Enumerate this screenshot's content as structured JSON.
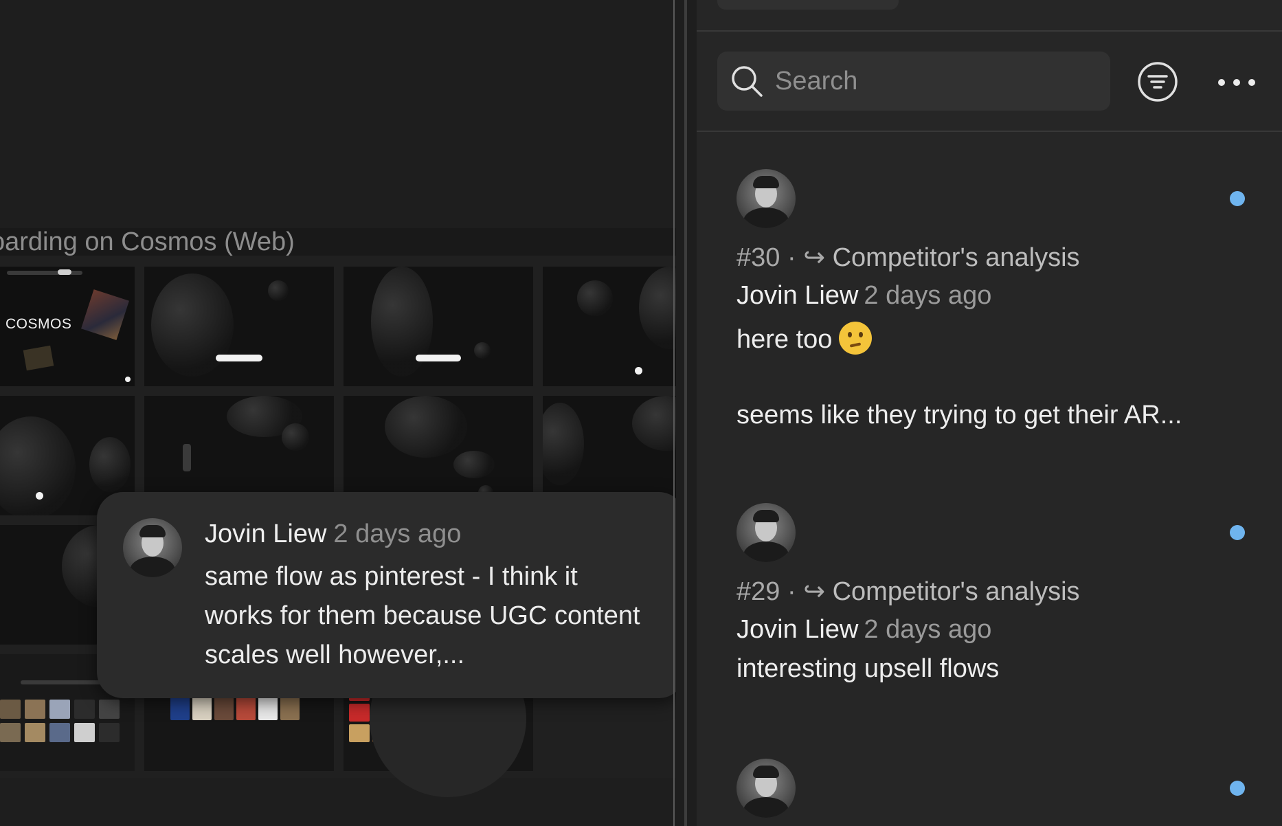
{
  "canvas": {
    "frame_title": "oarding on Cosmos (Web)",
    "cosmos_logo": "COSMOS"
  },
  "hover_comment": {
    "author": "Jovin Liew",
    "time": "2 days ago",
    "text": "same flow as pinterest - I think it works for them because UGC content scales well however,..."
  },
  "search": {
    "placeholder": "Search",
    "value": ""
  },
  "toolbar": {
    "filter_icon": "filter-icon",
    "more_icon": "more-icon"
  },
  "comments": [
    {
      "number": "#30",
      "separator": "·",
      "reply_icon": "↪",
      "frame": "Competitor's analysis",
      "author": "Jovin Liew",
      "time": "2 days ago",
      "line1": "here too",
      "emoji": "thinking-face",
      "line2": "seems like they trying to get their AR...",
      "unread": true
    },
    {
      "number": "#29",
      "separator": "·",
      "reply_icon": "↪",
      "frame": "Competitor's analysis",
      "author": "Jovin Liew",
      "time": "2 days ago",
      "line1": "interesting upsell flows",
      "unread": true
    },
    {
      "unread": true
    }
  ],
  "colors": {
    "background": "#1e1e1e",
    "panel": "#262626",
    "unread_dot": "#6fb4ee",
    "card": "#2b2b2b"
  }
}
